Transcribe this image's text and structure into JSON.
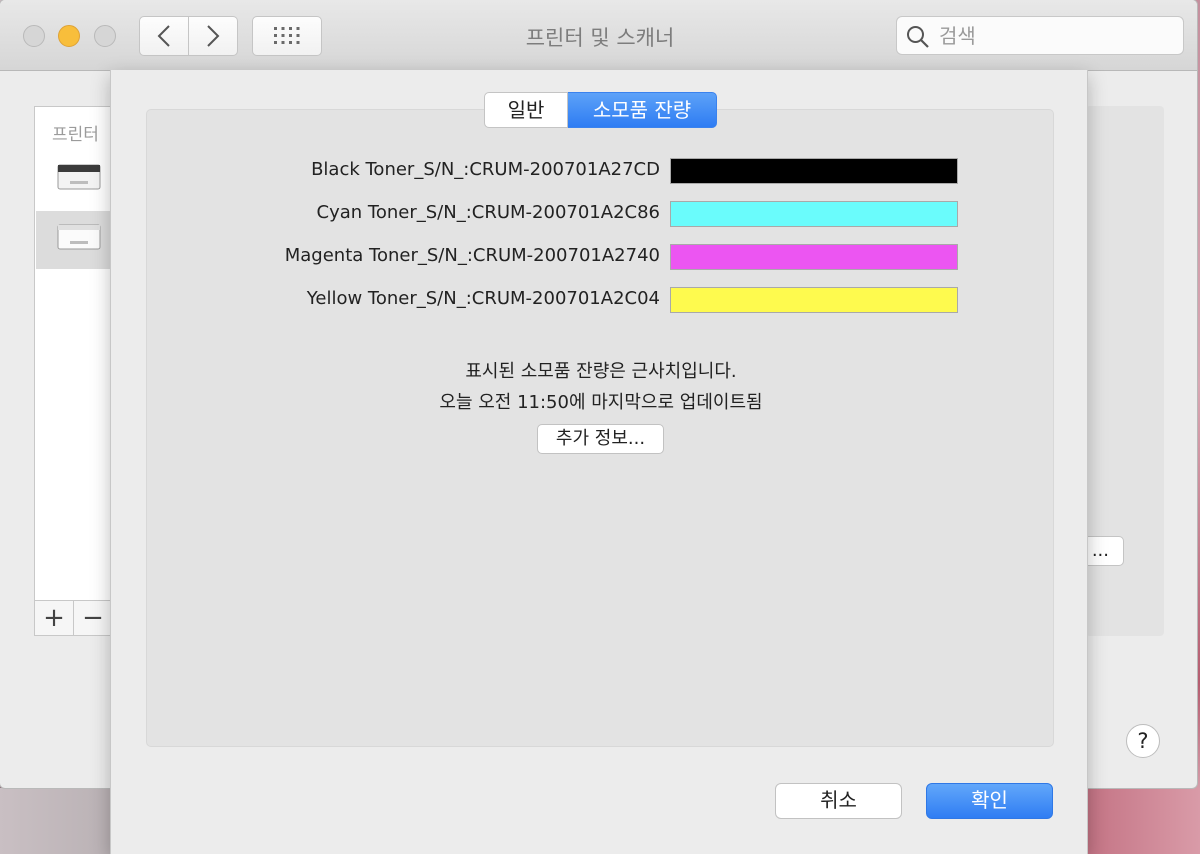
{
  "window": {
    "title": "프린터 및 스캐너",
    "search_placeholder": "검색"
  },
  "background": {
    "printer_list_header": "프린터",
    "add_label": "+",
    "remove_label": "−",
    "options_button_fragment": "...",
    "help_label": "?"
  },
  "sheet": {
    "tabs": [
      {
        "label": "일반",
        "selected": false
      },
      {
        "label": "소모품 잔량",
        "selected": true
      }
    ],
    "toners": [
      {
        "label": "Black Toner_S/N_:CRUM-200701A27CD",
        "color": "#000000",
        "level_percent": 100
      },
      {
        "label": "Cyan Toner_S/N_:CRUM-200701A2C86",
        "color": "#6afcfc",
        "level_percent": 100
      },
      {
        "label": "Magenta Toner_S/N_:CRUM-200701A2740",
        "color": "#ec55f2",
        "level_percent": 100
      },
      {
        "label": "Yellow Toner_S/N_:CRUM-200701A2C04",
        "color": "#fefa4e",
        "level_percent": 100
      }
    ],
    "note_line1": "표시된 소모품 잔량은 근사치입니다.",
    "note_line2": "오늘 오전 11:50에 마지막으로 업데이트됨",
    "more_info_label": "추가 정보...",
    "cancel_label": "취소",
    "ok_label": "확인"
  },
  "colors": {
    "accent_blue": "#2f7df3",
    "traffic_yellow": "#f8be3b"
  },
  "icons": [
    "back-chevron-icon",
    "forward-chevron-icon",
    "grid-icon",
    "search-icon",
    "printer-icon"
  ]
}
